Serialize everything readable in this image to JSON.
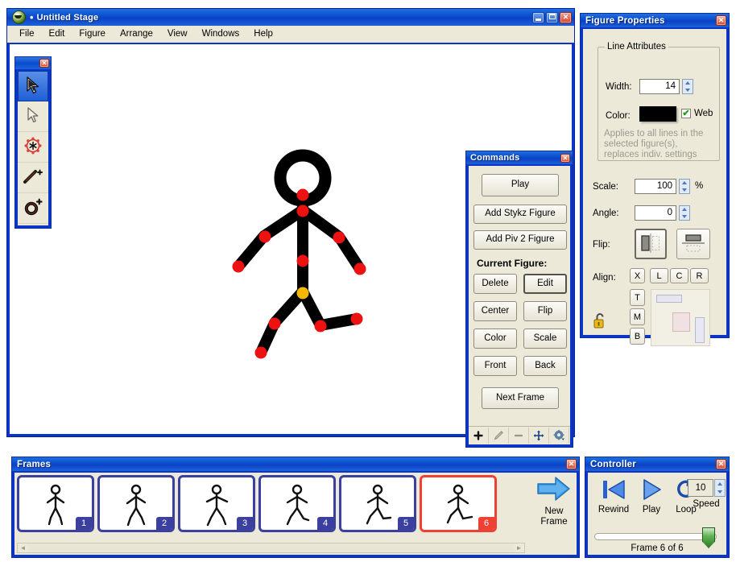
{
  "app": {
    "title": "Untitled Stage",
    "title_bullet": "•",
    "icon": "stykz-app-icon"
  },
  "window_controls": {
    "minimize": "minimize-icon",
    "maximize": "maximize-icon",
    "close": "✕"
  },
  "menubar": {
    "items": [
      {
        "label": "File"
      },
      {
        "label": "Edit"
      },
      {
        "label": "Figure"
      },
      {
        "label": "Arrange"
      },
      {
        "label": "View"
      },
      {
        "label": "Windows"
      },
      {
        "label": "Help"
      }
    ]
  },
  "tool_palette": {
    "close": "✕",
    "tools": [
      {
        "name": "select-tool",
        "icon": "filled-arrow-cursor-icon",
        "selected": true
      },
      {
        "name": "subselect-tool",
        "icon": "hollow-arrow-cursor-icon",
        "selected": false
      },
      {
        "name": "figure-tool",
        "icon": "node-circle-asterisk-icon",
        "selected": false
      },
      {
        "name": "add-line-tool",
        "icon": "line-plus-icon",
        "selected": false
      },
      {
        "name": "add-circle-tool",
        "icon": "circle-plus-icon",
        "selected": false
      }
    ]
  },
  "commands": {
    "title": "Commands",
    "close": "✕",
    "play": "Play",
    "add_stykz_figure": "Add Stykz Figure",
    "add_piv2_figure": "Add Piv 2 Figure",
    "current_figure_label": "Current Figure:",
    "buttons": [
      {
        "label": "Delete"
      },
      {
        "label": "Edit"
      },
      {
        "label": "Center"
      },
      {
        "label": "Flip"
      },
      {
        "label": "Color"
      },
      {
        "label": "Scale"
      },
      {
        "label": "Front"
      },
      {
        "label": "Back"
      }
    ],
    "next_frame": "Next Frame",
    "toolstrip": [
      {
        "name": "add-node-icon",
        "glyph": "+"
      },
      {
        "name": "edit-pencil-icon",
        "glyph": "✎"
      },
      {
        "name": "remove-node-icon",
        "glyph": "–"
      },
      {
        "name": "move-arrows-icon",
        "glyph": "✥"
      },
      {
        "name": "gear-options-icon",
        "glyph": "⚙"
      }
    ]
  },
  "figure_properties": {
    "title": "Figure Properties",
    "close": "✕",
    "line_attributes_label": "Line Attributes",
    "width_label": "Width:",
    "width_value": "14",
    "color_label": "Color:",
    "color_value": "#000000",
    "web_label": "Web",
    "web_checked": true,
    "hint": "Applies to all lines in the selected figure(s), replaces indiv. settings",
    "scale_label": "Scale:",
    "scale_value": "100",
    "scale_unit": "%",
    "angle_label": "Angle:",
    "angle_value": "0",
    "flip_label": "Flip:",
    "flip_horizontal": "flip-horizontal-icon",
    "flip_vertical": "flip-vertical-icon",
    "align_label": "Align:",
    "align_buttons": [
      "X",
      "L",
      "C",
      "R"
    ],
    "align_vertical_buttons": [
      "T",
      "M",
      "B"
    ],
    "lock_icon": "open-padlock-icon"
  },
  "frames": {
    "title": "Frames",
    "close": "✕",
    "items": [
      {
        "number": "1",
        "current": false
      },
      {
        "number": "2",
        "current": false
      },
      {
        "number": "3",
        "current": false
      },
      {
        "number": "4",
        "current": false
      },
      {
        "number": "5",
        "current": false
      },
      {
        "number": "6",
        "current": true
      }
    ],
    "new_frame_label": "New\nFrame",
    "new_frame_line1": "New",
    "new_frame_line2": "Frame",
    "new_frame_icon": "right-arrow-icon",
    "scroll_left": "◄",
    "scroll_right": "►"
  },
  "controller": {
    "title": "Controller",
    "close": "✕",
    "rewind_label": "Rewind",
    "rewind_icon": "rewind-to-start-icon",
    "play_label": "Play",
    "play_icon": "play-triangle-icon",
    "loop_label": "Loop",
    "loop_icon": "loop-circular-arrow-icon",
    "speed_label": "Speed",
    "speed_value": "10",
    "frame_status": "Frame 6 of 6"
  },
  "canvas": {
    "figure_name": "stick-figure",
    "joint_color": "#ee1111",
    "root_joint_color": "#f5b800",
    "line_color": "#000000"
  },
  "colors": {
    "titlebar_blue": "#0a4ccc",
    "panel_face": "#ece9d8",
    "frame_border": "#3b3f9e",
    "current_frame_border": "#ef4034"
  }
}
